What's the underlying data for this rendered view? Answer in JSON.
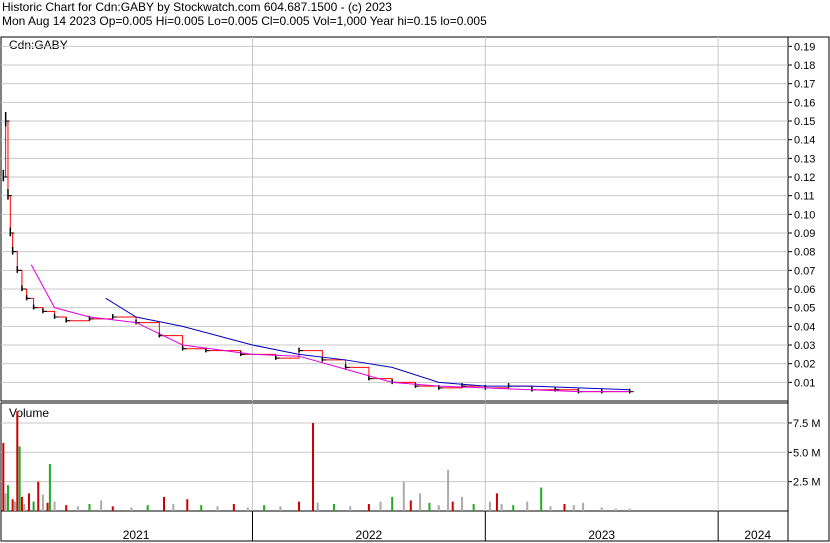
{
  "header": {
    "line1": "Historic Chart for Cdn:GABY by Stockwatch.com 604.687.1500 - (c) 2023",
    "line2": "Mon Aug 14 2023  Op=0.005  Hi=0.005  Lo=0.005  Cl=0.005  Vol=1,000  Year hi=0.15  lo=0.005"
  },
  "colors": {
    "price_bar": "#000000",
    "ma_short": "#e000e0",
    "ma_long": "#0000c0",
    "close_line": "#ff0000",
    "vol_up": "#22aa22",
    "vol_down": "#cc0000",
    "vol_neutral": "#aaaaaa",
    "grid": "#c8c8c8"
  },
  "chart_data": [
    {
      "type": "line",
      "title": "Cdn:GABY",
      "ylim": [
        0,
        0.195
      ],
      "yticks": [
        "0.19",
        "0.18",
        "0.17",
        "0.16",
        "0.15",
        "0.14",
        "0.13",
        "0.12",
        "0.11",
        "0.10",
        "0.09",
        "0.08",
        "0.07",
        "0.06",
        "0.05",
        "0.04",
        "0.03",
        "0.02",
        "0.01"
      ],
      "ytick_values": [
        0.19,
        0.18,
        0.17,
        0.16,
        0.15,
        0.14,
        0.13,
        0.12,
        0.11,
        0.1,
        0.09,
        0.08,
        0.07,
        0.06,
        0.05,
        0.04,
        0.03,
        0.02,
        0.01
      ],
      "xlim": [
        2020.92,
        2024.3
      ],
      "x_tick_labels": [
        "2021",
        "2022",
        "2023",
        "2024"
      ],
      "x_label_positions": [
        2021.5,
        2022.5,
        2023.5,
        2024.17
      ],
      "x_boundaries": [
        2022.0,
        2023.0,
        2024.0
      ],
      "price_points": [
        {
          "x": 2020.93,
          "y": 0.12
        },
        {
          "x": 2020.94,
          "y": 0.15
        },
        {
          "x": 2020.95,
          "y": 0.11
        },
        {
          "x": 2020.96,
          "y": 0.09
        },
        {
          "x": 2020.97,
          "y": 0.08
        },
        {
          "x": 2020.99,
          "y": 0.07
        },
        {
          "x": 2021.01,
          "y": 0.06
        },
        {
          "x": 2021.03,
          "y": 0.055
        },
        {
          "x": 2021.06,
          "y": 0.05
        },
        {
          "x": 2021.1,
          "y": 0.048
        },
        {
          "x": 2021.15,
          "y": 0.045
        },
        {
          "x": 2021.2,
          "y": 0.043
        },
        {
          "x": 2021.3,
          "y": 0.044
        },
        {
          "x": 2021.4,
          "y": 0.045
        },
        {
          "x": 2021.5,
          "y": 0.042
        },
        {
          "x": 2021.6,
          "y": 0.035
        },
        {
          "x": 2021.7,
          "y": 0.028
        },
        {
          "x": 2021.8,
          "y": 0.027
        },
        {
          "x": 2021.95,
          "y": 0.025
        },
        {
          "x": 2022.1,
          "y": 0.023
        },
        {
          "x": 2022.2,
          "y": 0.027
        },
        {
          "x": 2022.3,
          "y": 0.022
        },
        {
          "x": 2022.4,
          "y": 0.018
        },
        {
          "x": 2022.5,
          "y": 0.012
        },
        {
          "x": 2022.6,
          "y": 0.01
        },
        {
          "x": 2022.7,
          "y": 0.008
        },
        {
          "x": 2022.8,
          "y": 0.007
        },
        {
          "x": 2022.9,
          "y": 0.008
        },
        {
          "x": 2023.0,
          "y": 0.007
        },
        {
          "x": 2023.1,
          "y": 0.008
        },
        {
          "x": 2023.2,
          "y": 0.006
        },
        {
          "x": 2023.3,
          "y": 0.006
        },
        {
          "x": 2023.4,
          "y": 0.005
        },
        {
          "x": 2023.5,
          "y": 0.005
        },
        {
          "x": 2023.62,
          "y": 0.005
        }
      ],
      "ma_short_points": [
        {
          "x": 2021.05,
          "y": 0.073
        },
        {
          "x": 2021.15,
          "y": 0.05
        },
        {
          "x": 2021.3,
          "y": 0.045
        },
        {
          "x": 2021.5,
          "y": 0.042
        },
        {
          "x": 2021.7,
          "y": 0.03
        },
        {
          "x": 2022.0,
          "y": 0.025
        },
        {
          "x": 2022.2,
          "y": 0.024
        },
        {
          "x": 2022.4,
          "y": 0.017
        },
        {
          "x": 2022.6,
          "y": 0.01
        },
        {
          "x": 2022.8,
          "y": 0.008
        },
        {
          "x": 2023.0,
          "y": 0.007
        },
        {
          "x": 2023.2,
          "y": 0.006
        },
        {
          "x": 2023.4,
          "y": 0.005
        },
        {
          "x": 2023.62,
          "y": 0.005
        }
      ],
      "ma_long_points": [
        {
          "x": 2021.37,
          "y": 0.055
        },
        {
          "x": 2021.5,
          "y": 0.045
        },
        {
          "x": 2021.7,
          "y": 0.04
        },
        {
          "x": 2022.0,
          "y": 0.03
        },
        {
          "x": 2022.2,
          "y": 0.025
        },
        {
          "x": 2022.4,
          "y": 0.022
        },
        {
          "x": 2022.6,
          "y": 0.018
        },
        {
          "x": 2022.8,
          "y": 0.01
        },
        {
          "x": 2023.0,
          "y": 0.008
        },
        {
          "x": 2023.2,
          "y": 0.008
        },
        {
          "x": 2023.4,
          "y": 0.007
        },
        {
          "x": 2023.62,
          "y": 0.006
        }
      ]
    },
    {
      "type": "bar",
      "title": "Volume",
      "ylim": [
        0,
        9.2
      ],
      "yticks": [
        "7.5 M",
        "5.0 M",
        "2.5 M"
      ],
      "ytick_values": [
        7.5,
        5.0,
        2.5
      ],
      "xlim": [
        2020.92,
        2024.3
      ],
      "bars": [
        {
          "x": 2020.93,
          "v": 5.8,
          "c": "vol_down"
        },
        {
          "x": 2020.94,
          "v": 1.5,
          "c": "vol_neutral"
        },
        {
          "x": 2020.95,
          "v": 2.2,
          "c": "vol_up"
        },
        {
          "x": 2020.97,
          "v": 1.0,
          "c": "vol_down"
        },
        {
          "x": 2020.98,
          "v": 0.8,
          "c": "vol_neutral"
        },
        {
          "x": 2020.99,
          "v": 8.5,
          "c": "vol_down"
        },
        {
          "x": 2021.0,
          "v": 5.5,
          "c": "vol_up"
        },
        {
          "x": 2021.01,
          "v": 1.2,
          "c": "vol_down"
        },
        {
          "x": 2021.02,
          "v": 0.6,
          "c": "vol_neutral"
        },
        {
          "x": 2021.04,
          "v": 1.5,
          "c": "vol_down"
        },
        {
          "x": 2021.06,
          "v": 0.8,
          "c": "vol_up"
        },
        {
          "x": 2021.08,
          "v": 2.5,
          "c": "vol_down"
        },
        {
          "x": 2021.1,
          "v": 1.4,
          "c": "vol_neutral"
        },
        {
          "x": 2021.12,
          "v": 0.7,
          "c": "vol_down"
        },
        {
          "x": 2021.13,
          "v": 4.0,
          "c": "vol_up"
        },
        {
          "x": 2021.15,
          "v": 0.8,
          "c": "vol_neutral"
        },
        {
          "x": 2021.2,
          "v": 0.5,
          "c": "vol_down"
        },
        {
          "x": 2021.25,
          "v": 0.4,
          "c": "vol_neutral"
        },
        {
          "x": 2021.3,
          "v": 0.6,
          "c": "vol_up"
        },
        {
          "x": 2021.35,
          "v": 0.9,
          "c": "vol_neutral"
        },
        {
          "x": 2021.4,
          "v": 0.4,
          "c": "vol_down"
        },
        {
          "x": 2021.48,
          "v": 0.3,
          "c": "vol_neutral"
        },
        {
          "x": 2021.55,
          "v": 0.5,
          "c": "vol_up"
        },
        {
          "x": 2021.62,
          "v": 1.2,
          "c": "vol_down"
        },
        {
          "x": 2021.66,
          "v": 0.6,
          "c": "vol_neutral"
        },
        {
          "x": 2021.72,
          "v": 1.0,
          "c": "vol_down"
        },
        {
          "x": 2021.78,
          "v": 0.5,
          "c": "vol_up"
        },
        {
          "x": 2021.85,
          "v": 0.4,
          "c": "vol_neutral"
        },
        {
          "x": 2021.92,
          "v": 0.6,
          "c": "vol_down"
        },
        {
          "x": 2021.98,
          "v": 0.3,
          "c": "vol_neutral"
        },
        {
          "x": 2022.05,
          "v": 0.5,
          "c": "vol_up"
        },
        {
          "x": 2022.12,
          "v": 0.4,
          "c": "vol_neutral"
        },
        {
          "x": 2022.2,
          "v": 0.8,
          "c": "vol_down"
        },
        {
          "x": 2022.26,
          "v": 7.5,
          "c": "vol_down"
        },
        {
          "x": 2022.28,
          "v": 0.7,
          "c": "vol_neutral"
        },
        {
          "x": 2022.35,
          "v": 0.6,
          "c": "vol_up"
        },
        {
          "x": 2022.42,
          "v": 0.4,
          "c": "vol_neutral"
        },
        {
          "x": 2022.5,
          "v": 0.6,
          "c": "vol_down"
        },
        {
          "x": 2022.55,
          "v": 0.8,
          "c": "vol_neutral"
        },
        {
          "x": 2022.6,
          "v": 1.2,
          "c": "vol_up"
        },
        {
          "x": 2022.65,
          "v": 2.5,
          "c": "vol_neutral"
        },
        {
          "x": 2022.68,
          "v": 0.9,
          "c": "vol_down"
        },
        {
          "x": 2022.72,
          "v": 1.5,
          "c": "vol_neutral"
        },
        {
          "x": 2022.76,
          "v": 0.7,
          "c": "vol_up"
        },
        {
          "x": 2022.8,
          "v": 0.5,
          "c": "vol_neutral"
        },
        {
          "x": 2022.84,
          "v": 3.5,
          "c": "vol_neutral"
        },
        {
          "x": 2022.86,
          "v": 0.8,
          "c": "vol_down"
        },
        {
          "x": 2022.9,
          "v": 1.2,
          "c": "vol_neutral"
        },
        {
          "x": 2022.95,
          "v": 0.6,
          "c": "vol_up"
        },
        {
          "x": 2023.02,
          "v": 0.8,
          "c": "vol_neutral"
        },
        {
          "x": 2023.05,
          "v": 1.5,
          "c": "vol_down"
        },
        {
          "x": 2023.07,
          "v": 0.6,
          "c": "vol_neutral"
        },
        {
          "x": 2023.12,
          "v": 0.5,
          "c": "vol_up"
        },
        {
          "x": 2023.18,
          "v": 0.8,
          "c": "vol_neutral"
        },
        {
          "x": 2023.24,
          "v": 2.0,
          "c": "vol_up"
        },
        {
          "x": 2023.28,
          "v": 0.4,
          "c": "vol_neutral"
        },
        {
          "x": 2023.34,
          "v": 0.6,
          "c": "vol_down"
        },
        {
          "x": 2023.38,
          "v": 0.5,
          "c": "vol_neutral"
        },
        {
          "x": 2023.42,
          "v": 0.7,
          "c": "vol_neutral"
        },
        {
          "x": 2023.5,
          "v": 0.3,
          "c": "vol_neutral"
        },
        {
          "x": 2023.56,
          "v": 0.2,
          "c": "vol_neutral"
        },
        {
          "x": 2023.62,
          "v": 0.2,
          "c": "vol_neutral"
        }
      ]
    }
  ]
}
